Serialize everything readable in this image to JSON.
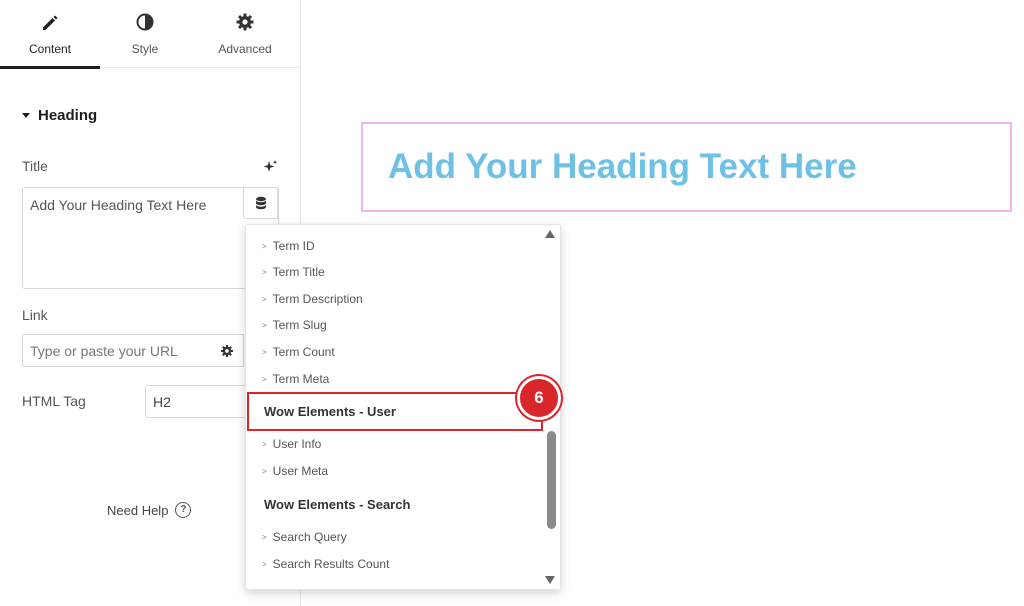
{
  "tabs": [
    {
      "label": "Content",
      "icon": "pencil-icon",
      "active": true
    },
    {
      "label": "Style",
      "icon": "half-circle-icon",
      "active": false
    },
    {
      "label": "Advanced",
      "icon": "gear-icon",
      "active": false
    }
  ],
  "section": {
    "title": "Heading"
  },
  "fields": {
    "title_label": "Title",
    "title_value": "Add Your Heading Text Here",
    "link_label": "Link",
    "link_placeholder": "Type or paste your URL",
    "html_tag_label": "HTML Tag",
    "html_tag_value": "H2"
  },
  "help": {
    "label": "Need Help",
    "icon": "question-circle-icon"
  },
  "canvas": {
    "heading": "Add Your Heading Text Here"
  },
  "dropdown": {
    "items_top": [
      "Term ID",
      "Term Title",
      "Term Description",
      "Term Slug",
      "Term Count",
      "Term Meta"
    ],
    "group_user": "Wow Elements - User",
    "items_user": [
      "User Info",
      "User Meta"
    ],
    "group_search": "Wow Elements - Search",
    "items_search": [
      "Search Query",
      "Search Results Count"
    ]
  },
  "annotation": {
    "step": "6"
  },
  "colors": {
    "accent_heading": "#6ec1e4",
    "highlight": "#d9262b",
    "canvas_border": "#f0b4ee"
  }
}
